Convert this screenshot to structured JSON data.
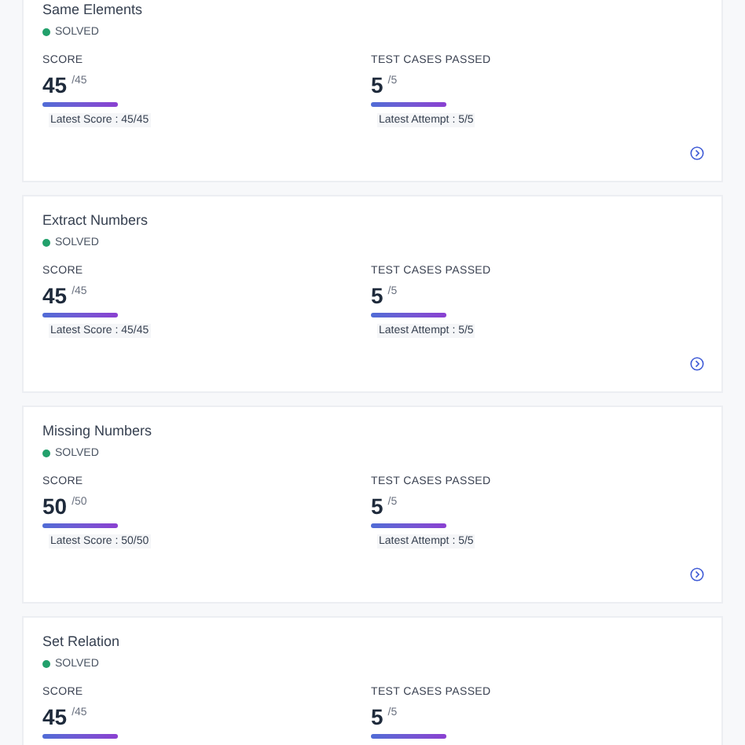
{
  "problems": [
    {
      "title": "Same Elements",
      "status": "SOLVED",
      "score_label": "SCORE",
      "score": "45",
      "score_max": "/45",
      "latest_score": "Latest Score : 45/45",
      "tests_label": "TEST CASES PASSED",
      "tests": "5",
      "tests_max": "/5",
      "latest_attempt": "Latest Attempt : 5/5"
    },
    {
      "title": "Extract Numbers",
      "status": "SOLVED",
      "score_label": "SCORE",
      "score": "45",
      "score_max": "/45",
      "latest_score": "Latest Score : 45/45",
      "tests_label": "TEST CASES PASSED",
      "tests": "5",
      "tests_max": "/5",
      "latest_attempt": "Latest Attempt : 5/5"
    },
    {
      "title": "Missing Numbers",
      "status": "SOLVED",
      "score_label": "SCORE",
      "score": "50",
      "score_max": "/50",
      "latest_score": "Latest Score : 50/50",
      "tests_label": "TEST CASES PASSED",
      "tests": "5",
      "tests_max": "/5",
      "latest_attempt": "Latest Attempt : 5/5"
    },
    {
      "title": "Set Relation",
      "status": "SOLVED",
      "score_label": "SCORE",
      "score": "45",
      "score_max": "/45",
      "tests_label": "TEST CASES PASSED",
      "tests": "5",
      "tests_max": "/5"
    }
  ]
}
